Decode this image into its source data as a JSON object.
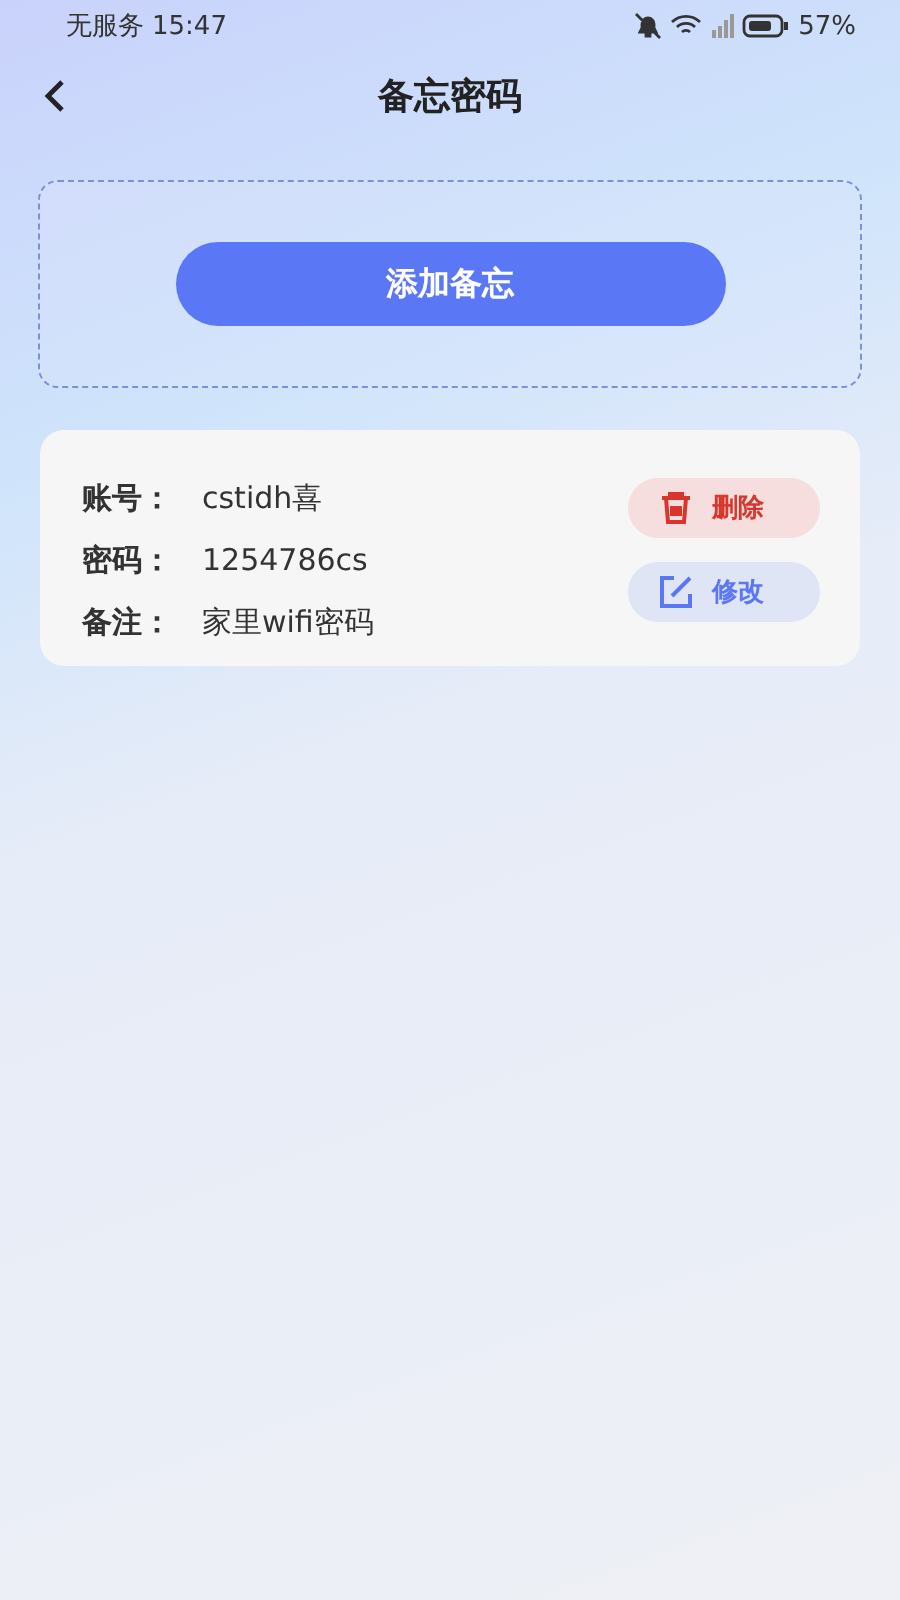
{
  "status_bar": {
    "carrier": "无服务",
    "time": "15:47",
    "battery": "57%"
  },
  "header": {
    "title": "备忘密码"
  },
  "add_button": {
    "label": "添加备忘"
  },
  "entries": [
    {
      "fields": [
        {
          "label": "账号：",
          "value": "cstidh喜"
        },
        {
          "label": "密码：",
          "value": "1254786cs"
        },
        {
          "label": "备注：",
          "value": "家里wifi密码"
        }
      ],
      "actions": [
        {
          "kind": "delete",
          "label": "删除"
        },
        {
          "kind": "edit",
          "label": "修改"
        }
      ]
    }
  ]
}
